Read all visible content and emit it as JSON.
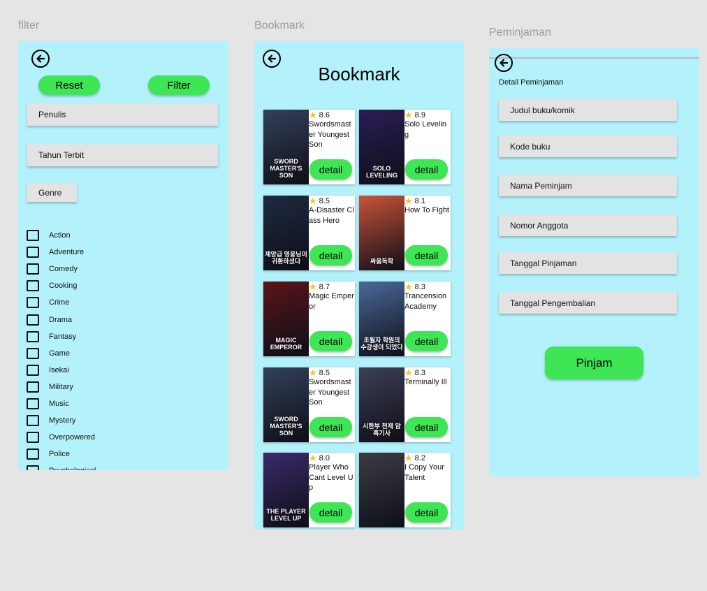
{
  "filter": {
    "frame_label": "filter",
    "reset_label": "Reset",
    "filter_label": "Filter",
    "penulis_label": "Penulis",
    "tahun_label": "Tahun Terbit",
    "genre_label": "Genre",
    "genres": [
      "Action",
      "Adventure",
      "Comedy",
      "Cooking",
      "Crime",
      "Drama",
      "Fantasy",
      "Game",
      "Isekai",
      "Military",
      "Music",
      "Mystery",
      "Overpowered",
      "Police",
      "Psychological"
    ]
  },
  "bookmark": {
    "frame_label": "Bookmark",
    "title": "Bookmark",
    "detail_label": "detail",
    "books": [
      {
        "rating": "8.6",
        "title": "Swordsmaster Youngest Son",
        "cover_text": "SWORD MASTER'S SON",
        "cover_color": "#33405a"
      },
      {
        "rating": "8.9",
        "title": "Solo Leveling",
        "cover_text": "SOLO LEVELING",
        "cover_color": "#2a1d55"
      },
      {
        "rating": "8.5",
        "title": "A-Disaster Class Hero",
        "cover_text": "재앙급 영웅님이 귀환하셨다",
        "cover_color": "#1e2a40"
      },
      {
        "rating": "8.1",
        "title": "How To Fight",
        "cover_text": "싸움독학",
        "cover_color": "#c9533a"
      },
      {
        "rating": "8.7",
        "title": "Magic Emperor",
        "cover_text": "MAGIC EMPEROR",
        "cover_color": "#5a1418"
      },
      {
        "rating": "8.3",
        "title": "Trancension Academy",
        "cover_text": "초월자 학원의 수강생이 되었다",
        "cover_color": "#4a6a9a"
      },
      {
        "rating": "8.5",
        "title": "Swordsmaster Youngest Son",
        "cover_text": "SWORD MASTER'S SON",
        "cover_color": "#33405a"
      },
      {
        "rating": "8.3",
        "title": "Terminally Ill",
        "cover_text": "시한부 천재 암흑기사",
        "cover_color": "#3d3f55"
      },
      {
        "rating": "8.0",
        "title": "Player Who Cant Level Up",
        "cover_text": "THE PLAYER LEVEL UP",
        "cover_color": "#3a2a6a"
      },
      {
        "rating": "8.2",
        "title": "I Copy Your Talent",
        "cover_text": "",
        "cover_color": "#3b3d44"
      }
    ]
  },
  "peminjaman": {
    "frame_label": "Peminjaman",
    "section_title": "Detail Peminjaman",
    "fields": [
      "Judul buku/komik",
      "Kode buku",
      "Nama Peminjam",
      "Nomor Anggota",
      "Tanggal Pinjaman",
      "Tanggal Pengembalian"
    ],
    "submit_label": "Pinjam"
  },
  "colors": {
    "panel_bg": "#b3f1fb",
    "accent_green": "#3ee554",
    "field_grey": "#e3e3e3",
    "star": "#f5c518"
  },
  "icons": [
    "back-arrow-icon",
    "star-icon",
    "checkbox-icon"
  ]
}
